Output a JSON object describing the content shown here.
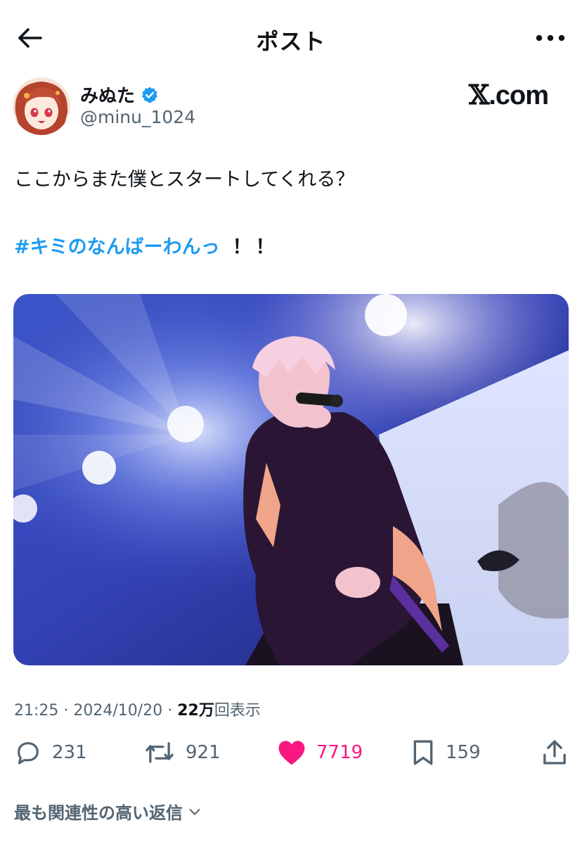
{
  "header": {
    "title": "ポスト",
    "back_icon": "arrow-left-icon",
    "more_icon": "more-horizontal-icon"
  },
  "author": {
    "display_name": "みぬた",
    "handle": "@minu_1024",
    "verified_icon": "verified-badge-icon"
  },
  "source_logo": {
    "mark": "𝕏",
    "domain": ".com"
  },
  "tweet": {
    "text": "ここからまた僕とスタートしてくれる？",
    "hashtag": "#キミのなんばーわんっ",
    "suffix": "！！"
  },
  "meta": {
    "time": "21:25",
    "sep1": "·",
    "date": "2024/10/20",
    "sep2": "·",
    "views_num": "22万",
    "views_label": "回表示"
  },
  "actions": {
    "reply": {
      "icon": "reply-icon",
      "count": "231"
    },
    "repost": {
      "icon": "repost-icon",
      "count": "921"
    },
    "like": {
      "icon": "heart-icon",
      "count": "7719",
      "active": true
    },
    "bookmark": {
      "icon": "bookmark-icon",
      "count": "159"
    },
    "share": {
      "icon": "share-icon"
    }
  },
  "replies_sort": {
    "label": "最も関連性の高い返信",
    "icon": "chevron-down-icon"
  },
  "colors": {
    "link": "#1d9bf0",
    "like": "#f91880",
    "secondary": "#536471",
    "text": "#0f1419"
  }
}
